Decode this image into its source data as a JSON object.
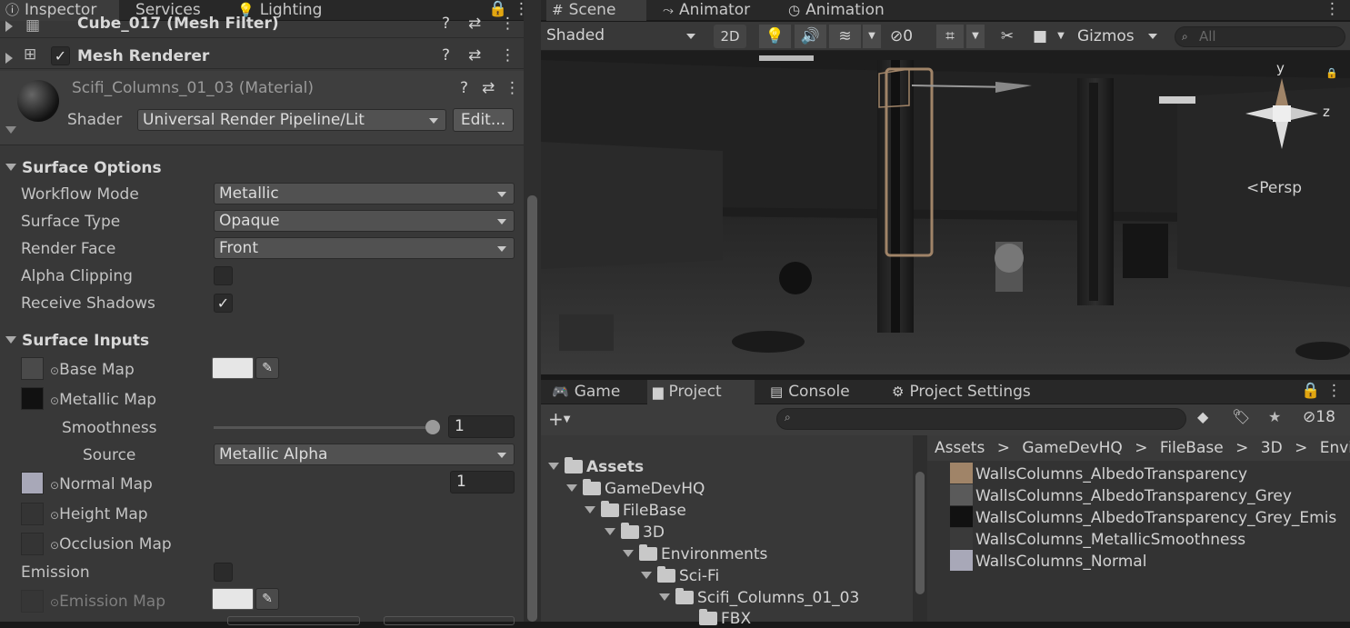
{
  "inspector": {
    "tabs": [
      "Inspector",
      "Services",
      "Lighting"
    ],
    "components": {
      "mesh_filter": "Cube_017 (Mesh Filter)",
      "mesh_renderer": "Mesh Renderer"
    },
    "material": {
      "name": "Scifi_Columns_01_03 (Material)",
      "shader_label": "Shader",
      "shader_value": "Universal Render Pipeline/Lit",
      "edit_label": "Edit..."
    },
    "surface_options": {
      "title": "Surface Options",
      "rows": [
        {
          "label": "Workflow Mode",
          "value": "Metallic"
        },
        {
          "label": "Surface Type",
          "value": "Opaque"
        },
        {
          "label": "Render Face",
          "value": "Front"
        }
      ],
      "alpha_clipping": {
        "label": "Alpha Clipping",
        "checked": false
      },
      "receive_shadows": {
        "label": "Receive Shadows",
        "checked": true
      }
    },
    "surface_inputs": {
      "title": "Surface Inputs",
      "base_map": "Base Map",
      "metallic_map": "Metallic Map",
      "smoothness": {
        "label": "Smoothness",
        "value": "1",
        "fraction": 1.0
      },
      "source": {
        "label": "Source",
        "value": "Metallic Alpha"
      },
      "normal_map": {
        "label": "Normal Map",
        "value": "1"
      },
      "height_map": "Height Map",
      "occlusion_map": "Occlusion Map",
      "emission": {
        "label": "Emission",
        "checked": false
      },
      "emission_map": "Emission Map"
    }
  },
  "scene": {
    "tabs": [
      "Scene",
      "Animator",
      "Animation"
    ],
    "toolbar": {
      "shading_mode": "Shaded",
      "mode_2d": "2D",
      "hidden_count": "0",
      "gizmos": "Gizmos",
      "search_placeholder": "All"
    },
    "gizmo": {
      "y": "y",
      "z": "z",
      "projection": "Persp"
    }
  },
  "bottom": {
    "tabs": [
      "Game",
      "Project",
      "Console",
      "Project Settings"
    ],
    "hidden_count": "18",
    "breadcrumb": [
      "Assets",
      "GameDevHQ",
      "FileBase",
      "3D",
      "Environm"
    ],
    "tree": [
      {
        "label": "Assets",
        "bold": true
      },
      {
        "label": "GameDevHQ"
      },
      {
        "label": "FileBase"
      },
      {
        "label": "3D"
      },
      {
        "label": "Environments"
      },
      {
        "label": "Sci-Fi"
      },
      {
        "label": "Scifi_Columns_01_03"
      },
      {
        "label": "FBX"
      }
    ],
    "assets": [
      {
        "label": "WallsColumns_AlbedoTransparency",
        "color": "#a08468"
      },
      {
        "label": "WallsColumns_AlbedoTransparency_Grey",
        "color": "#5a5a5a"
      },
      {
        "label": "WallsColumns_AlbedoTransparency_Grey_Emis",
        "color": "#111111"
      },
      {
        "label": "WallsColumns_MetallicSmoothness",
        "color": "#3a3a3a"
      },
      {
        "label": "WallsColumns_Normal",
        "color": "#a8a8b8"
      }
    ]
  }
}
